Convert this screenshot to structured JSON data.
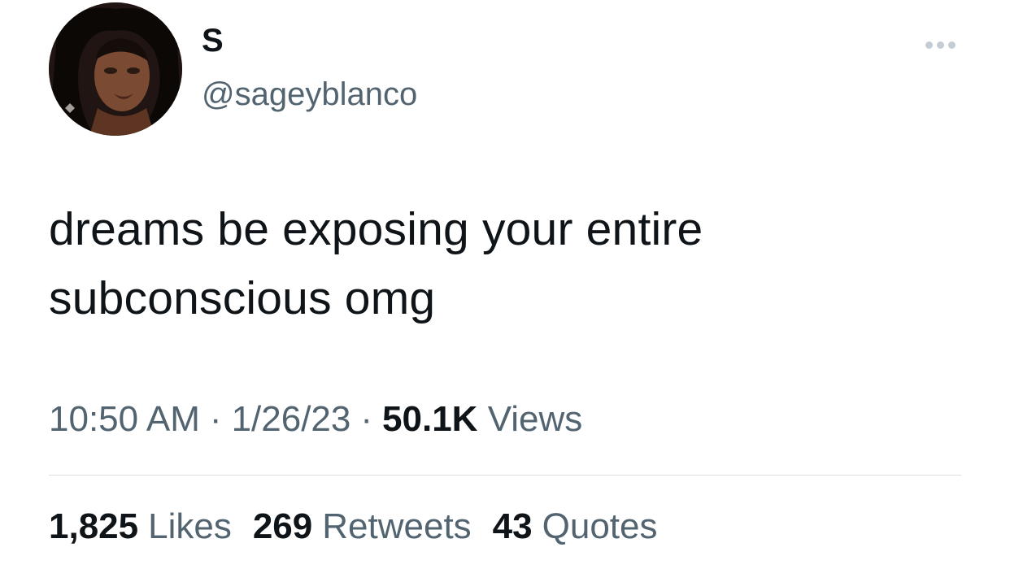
{
  "author": {
    "display_name": "S",
    "handle": "@sageyblanco",
    "avatar_icon": "profile-photo"
  },
  "more_icon": "more-options-icon",
  "tweet": {
    "text": "dreams be exposing your entire\nsubconscious omg"
  },
  "meta": {
    "time": "10:50 AM",
    "separator": "·",
    "date": "1/26/23",
    "views_count": "50.1K",
    "views_label": "Views"
  },
  "stats": {
    "likes_count": "1,825",
    "likes_label": "Likes",
    "retweets_count": "269",
    "retweets_label": "Retweets",
    "quotes_count": "43",
    "quotes_label": "Quotes"
  },
  "colors": {
    "primary_text": "#0f1419",
    "secondary_text": "#536471",
    "divider": "#dadfe3"
  }
}
